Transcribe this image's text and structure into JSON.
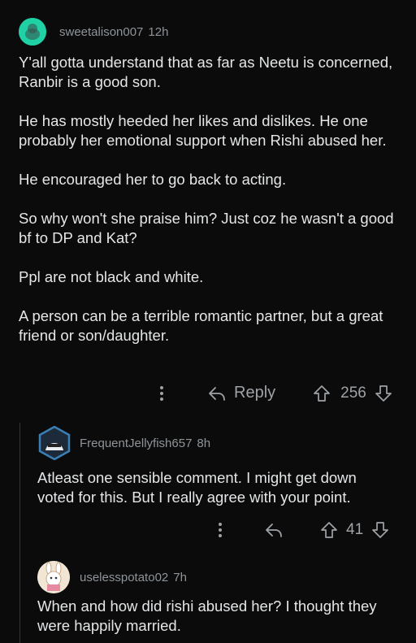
{
  "comments": [
    {
      "username": "sweetalison007",
      "age": "12h",
      "paragraphs": [
        "Y'all gotta understand that as far as Neetu is concerned, Ranbir is a good son.",
        "He has mostly heeded her likes and dislikes. He one probably her emotional support when Rishi abused her.",
        "He encouraged her to go back to acting.",
        "So why won't she praise him? Just coz he wasn't a good bf to DP and Kat?",
        "Ppl are not black and white.",
        "A person can be a terrible romantic partner, but a great friend or son/daughter."
      ],
      "reply_label": "Reply",
      "score": "256",
      "avatar_color": "#1fd1a4"
    },
    {
      "username": "FrequentJellyfish657",
      "age": "8h",
      "paragraphs": [
        "Atleast one sensible comment. I might get down voted for this. But I really agree with your point."
      ],
      "score": "41",
      "avatar_color": "#3a7fb5"
    },
    {
      "username": "uselesspotato02",
      "age": "7h",
      "paragraphs": [
        "When and how did rishi abused her? I thought they were happily married."
      ],
      "avatar_color": "#f1e6d4"
    }
  ],
  "icons": [
    "more-options-icon",
    "reply-arrow-icon",
    "upvote-icon",
    "downvote-icon"
  ]
}
